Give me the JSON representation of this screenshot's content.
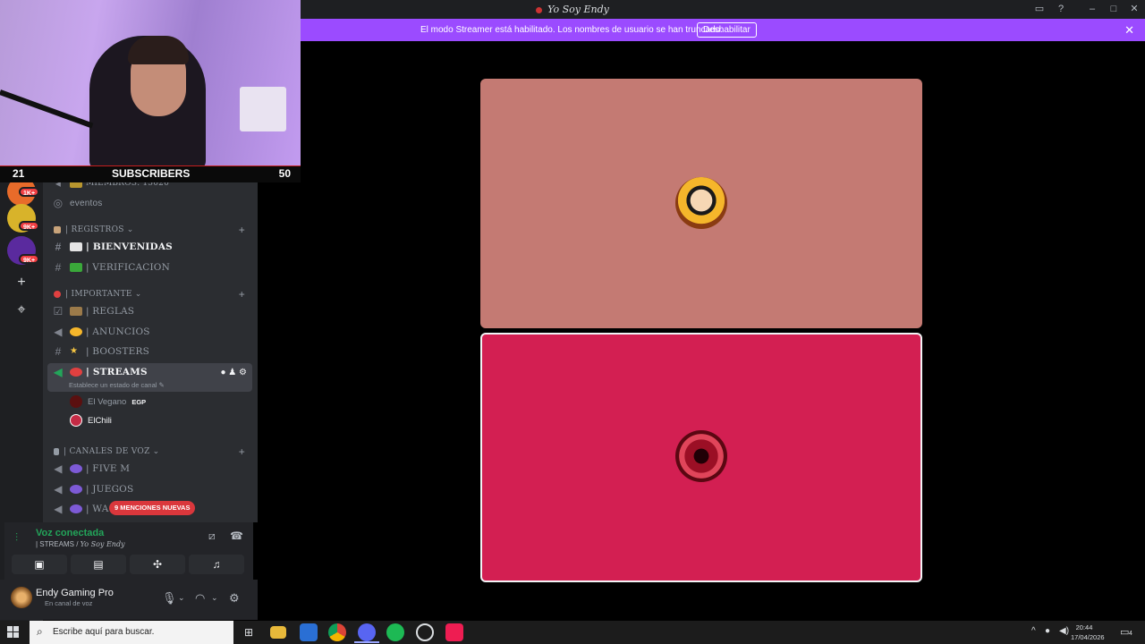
{
  "window": {
    "title": "Yo Soy Endy",
    "controls": [
      "inbox-icon",
      "help-icon",
      "minimize-icon",
      "maximize-icon",
      "close-icon"
    ]
  },
  "banner": {
    "text": "El modo Streamer está habilitado. Los nombres de usuario se han truncado.",
    "button_label": "Deshabilitar",
    "close_glyph": "✕"
  },
  "webcam": {
    "left_count": "21",
    "center_text": "SUBSCRIBERS",
    "right_count": "50"
  },
  "rail": {
    "badges": [
      "1K+",
      "9K+",
      "9K+"
    ],
    "add_glyph": "+",
    "discover_glyph": "⌖"
  },
  "sidebar": {
    "partial_top": "MIEMBROS: 15020",
    "events_label": "eventos",
    "categories": {
      "registros": "| REGISTROS",
      "importante": "| IMPORTANTE",
      "voz": "| CANALES DE VOZ"
    },
    "channels": {
      "bienvenidas": "| BIENVENIDAS",
      "verificacion": "| VERIFICACION",
      "reglas": "| REGLAS",
      "anuncios": "| ANUNCIOS",
      "boosters": "| BOOSTERS",
      "streams": "| STREAMS",
      "fivem": "| FIVE M",
      "juegos": "| JUEGOS",
      "wa": "| WA"
    },
    "streams_status": "Establece un estado de canal",
    "voice_users": [
      {
        "name": "El Vegano",
        "tag": "EGP"
      },
      {
        "name": "ElChili",
        "tag": ""
      }
    ],
    "mentions_pill": "9 MENCIONES NUEVAS"
  },
  "voice_panel": {
    "status": "Voz conectada",
    "channel_prefix": "| STREAMS / ",
    "server_name": "Yo Soy Endy"
  },
  "user_panel": {
    "name": "Endy Gaming Pro",
    "status": "En canal de voz"
  },
  "taskbar": {
    "search_placeholder": "Escribe aquí para buscar.",
    "time": "20:44",
    "date": "17/04/2026",
    "notification_count": "4"
  },
  "colors": {
    "banner": "#9b4bff",
    "tile_1": "#c47a73",
    "tile_2": "#d31f52",
    "voice_connected": "#23a55a",
    "mention_red": "#da373c"
  }
}
